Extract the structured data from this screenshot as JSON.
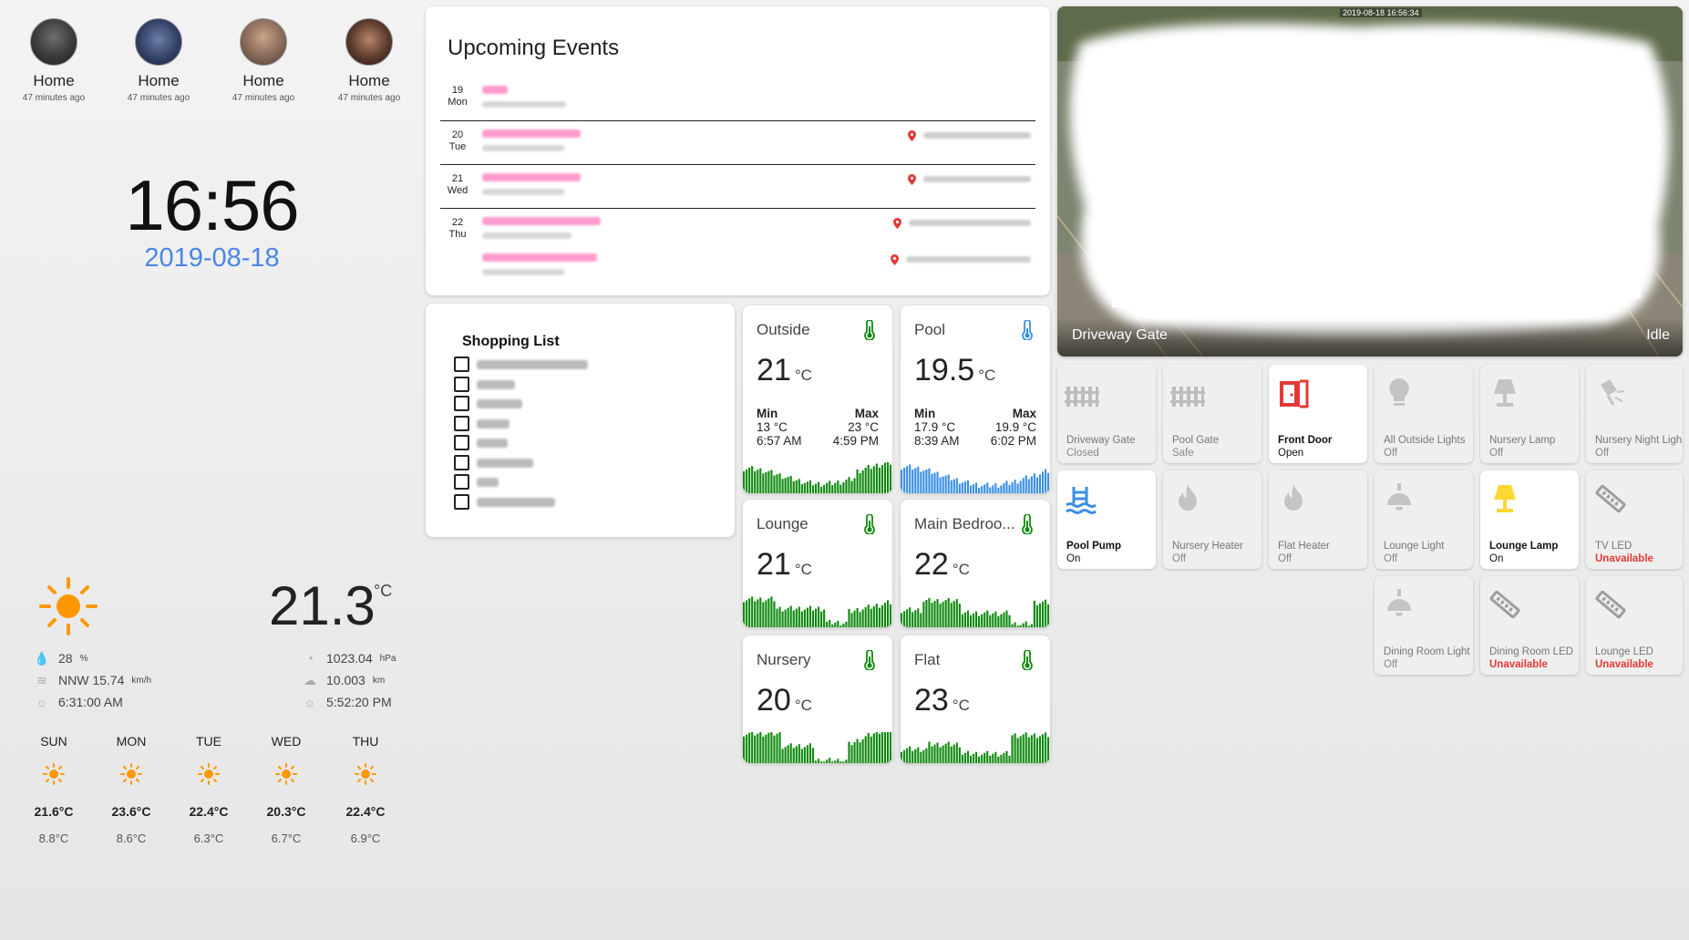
{
  "persons": [
    {
      "name": "Home",
      "time": "47 minutes ago"
    },
    {
      "name": "Home",
      "time": "47 minutes ago"
    },
    {
      "name": "Home",
      "time": "47 minutes ago"
    },
    {
      "name": "Home",
      "time": "47 minutes ago"
    }
  ],
  "clock": {
    "time": "16:56",
    "date": "2019-08-18"
  },
  "weather": {
    "icon": "sunny-icon",
    "temperature": "21.3",
    "unit": "°C",
    "humidity": "28",
    "humidity_unit": "%",
    "wind": "NNW 15.74",
    "wind_unit": "km/h",
    "sunrise": "6:31:00 AM",
    "pressure": "1023.04",
    "pressure_unit": "hPa",
    "visibility": "10.003",
    "visibility_unit": "km",
    "sunset": "5:52:20 PM",
    "forecast": [
      {
        "day": "SUN",
        "high": "21.6°C",
        "low": "8.8°C"
      },
      {
        "day": "MON",
        "high": "23.6°C",
        "low": "8.6°C"
      },
      {
        "day": "TUE",
        "high": "22.4°C",
        "low": "6.3°C"
      },
      {
        "day": "WED",
        "high": "20.3°C",
        "low": "6.7°C"
      },
      {
        "day": "THU",
        "high": "22.4°C",
        "low": "6.9°C"
      }
    ],
    "sun_color": "#ff9800"
  },
  "events": {
    "title": "Upcoming Events",
    "days": [
      {
        "num": "19",
        "dow": "Mon"
      },
      {
        "num": "20",
        "dow": "Tue"
      },
      {
        "num": "21",
        "dow": "Wed"
      },
      {
        "num": "22",
        "dow": "Thu"
      }
    ],
    "accent": "#ff69b4"
  },
  "shopping": {
    "title": "Shopping List",
    "item_count": 8
  },
  "sensors": [
    {
      "name": "Outside",
      "value": "21",
      "unit": "°C",
      "min_label": "Min",
      "max_label": "Max",
      "min": "13 °C",
      "min_time": "6:57 AM",
      "max": "23 °C",
      "max_time": "4:59 PM",
      "icon": "thermometer-icon",
      "color": "#0f8a0f"
    },
    {
      "name": "Pool",
      "value": "19.5",
      "unit": "°C",
      "min_label": "Min",
      "max_label": "Max",
      "min": "17.9 °C",
      "min_time": "8:39 AM",
      "max": "19.9 °C",
      "max_time": "6:02 PM",
      "icon": "thermometer-icon",
      "color": "#3a8ee6"
    },
    {
      "name": "Lounge",
      "value": "21",
      "unit": "°C",
      "icon": "thermometer-icon",
      "color": "#0f8a0f"
    },
    {
      "name": "Main Bedroo...",
      "value": "22",
      "unit": "°C",
      "icon": "thermometer-icon",
      "color": "#0f8a0f"
    },
    {
      "name": "Nursery",
      "value": "20",
      "unit": "°C",
      "icon": "thermometer-icon",
      "color": "#0f8a0f"
    },
    {
      "name": "Flat",
      "value": "23",
      "unit": "°C",
      "icon": "thermometer-icon",
      "color": "#0f8a0f"
    }
  ],
  "camera": {
    "timestamp": "2019-08-18 16:56:34",
    "name": "Driveway Gate",
    "state": "Idle"
  },
  "tiles": [
    {
      "name": "Driveway Gate",
      "state": "Closed",
      "icon": "gate-icon",
      "on": false
    },
    {
      "name": "Pool Gate",
      "state": "Safe",
      "icon": "gate-icon",
      "on": false
    },
    {
      "name": "Front Door",
      "state": "Open",
      "icon": "door-open-icon",
      "on": true
    },
    {
      "name": "All Outside Lights",
      "state": "Off",
      "icon": "lightbulb-icon",
      "on": false
    },
    {
      "name": "Nursery Lamp",
      "state": "Off",
      "icon": "lamp-icon",
      "on": false
    },
    {
      "name": "Nursery Night Ligh",
      "state": "Off",
      "icon": "night-light-icon",
      "on": false
    },
    {
      "name": "Pool Pump",
      "state": "On",
      "icon": "pool-icon",
      "on": true
    },
    {
      "name": "Nursery Heater",
      "state": "Off",
      "icon": "fire-icon",
      "on": false
    },
    {
      "name": "Flat Heater",
      "state": "Off",
      "icon": "fire-icon",
      "on": false
    },
    {
      "name": "Lounge Light",
      "state": "Off",
      "icon": "ceiling-light-icon",
      "on": false
    },
    {
      "name": "Lounge Lamp",
      "state": "On",
      "icon": "lamp-icon",
      "on": true
    },
    {
      "name": "TV LED",
      "state": "Unavailable",
      "icon": "led-strip-icon",
      "on": false
    },
    {
      "name": "Dining Room Light",
      "state": "Off",
      "icon": "ceiling-light-icon",
      "on": false
    },
    {
      "name": "Dining Room LED",
      "state": "Unavailable",
      "icon": "led-strip-icon",
      "on": false
    },
    {
      "name": "Lounge LED",
      "state": "Unavailable",
      "icon": "led-strip-icon",
      "on": false
    }
  ]
}
